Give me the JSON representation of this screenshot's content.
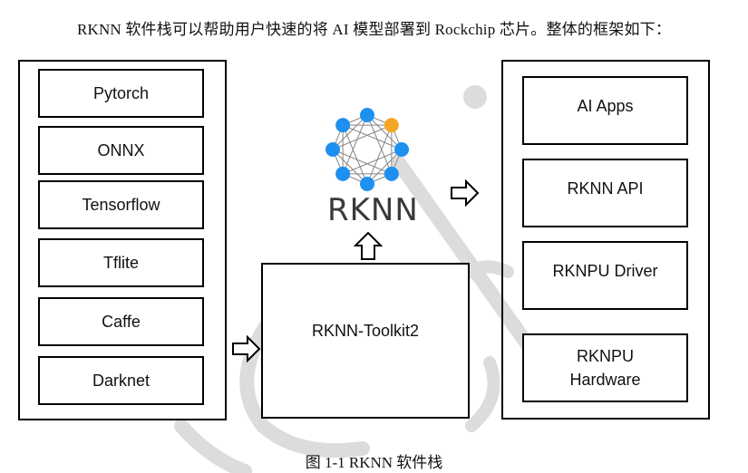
{
  "intro_text": "RKNN 软件栈可以帮助用户快速的将 AI 模型部署到 Rockchip 芯片。整体的框架如下：",
  "caption": "图 1-1 RKNN 软件栈",
  "frameworks": {
    "items": [
      {
        "label": "Pytorch"
      },
      {
        "label": "ONNX"
      },
      {
        "label": "Tensorflow"
      },
      {
        "label": "Tflite"
      },
      {
        "label": "Caffe"
      },
      {
        "label": "Darknet"
      }
    ]
  },
  "toolkit": {
    "label": "RKNN-Toolkit2"
  },
  "rknn_logo": {
    "text": "RKNN",
    "node_color": "#1e90f0",
    "highlight_color": "#f5a623",
    "edge_color": "#888888"
  },
  "runtime_stack": {
    "items": [
      {
        "label": "AI Apps"
      },
      {
        "label": "RKNN API"
      },
      {
        "label": "RKNPU Driver"
      },
      {
        "label": "RKNPU\nHardware",
        "line1": "RKNPU",
        "line2": "Hardware"
      }
    ]
  }
}
